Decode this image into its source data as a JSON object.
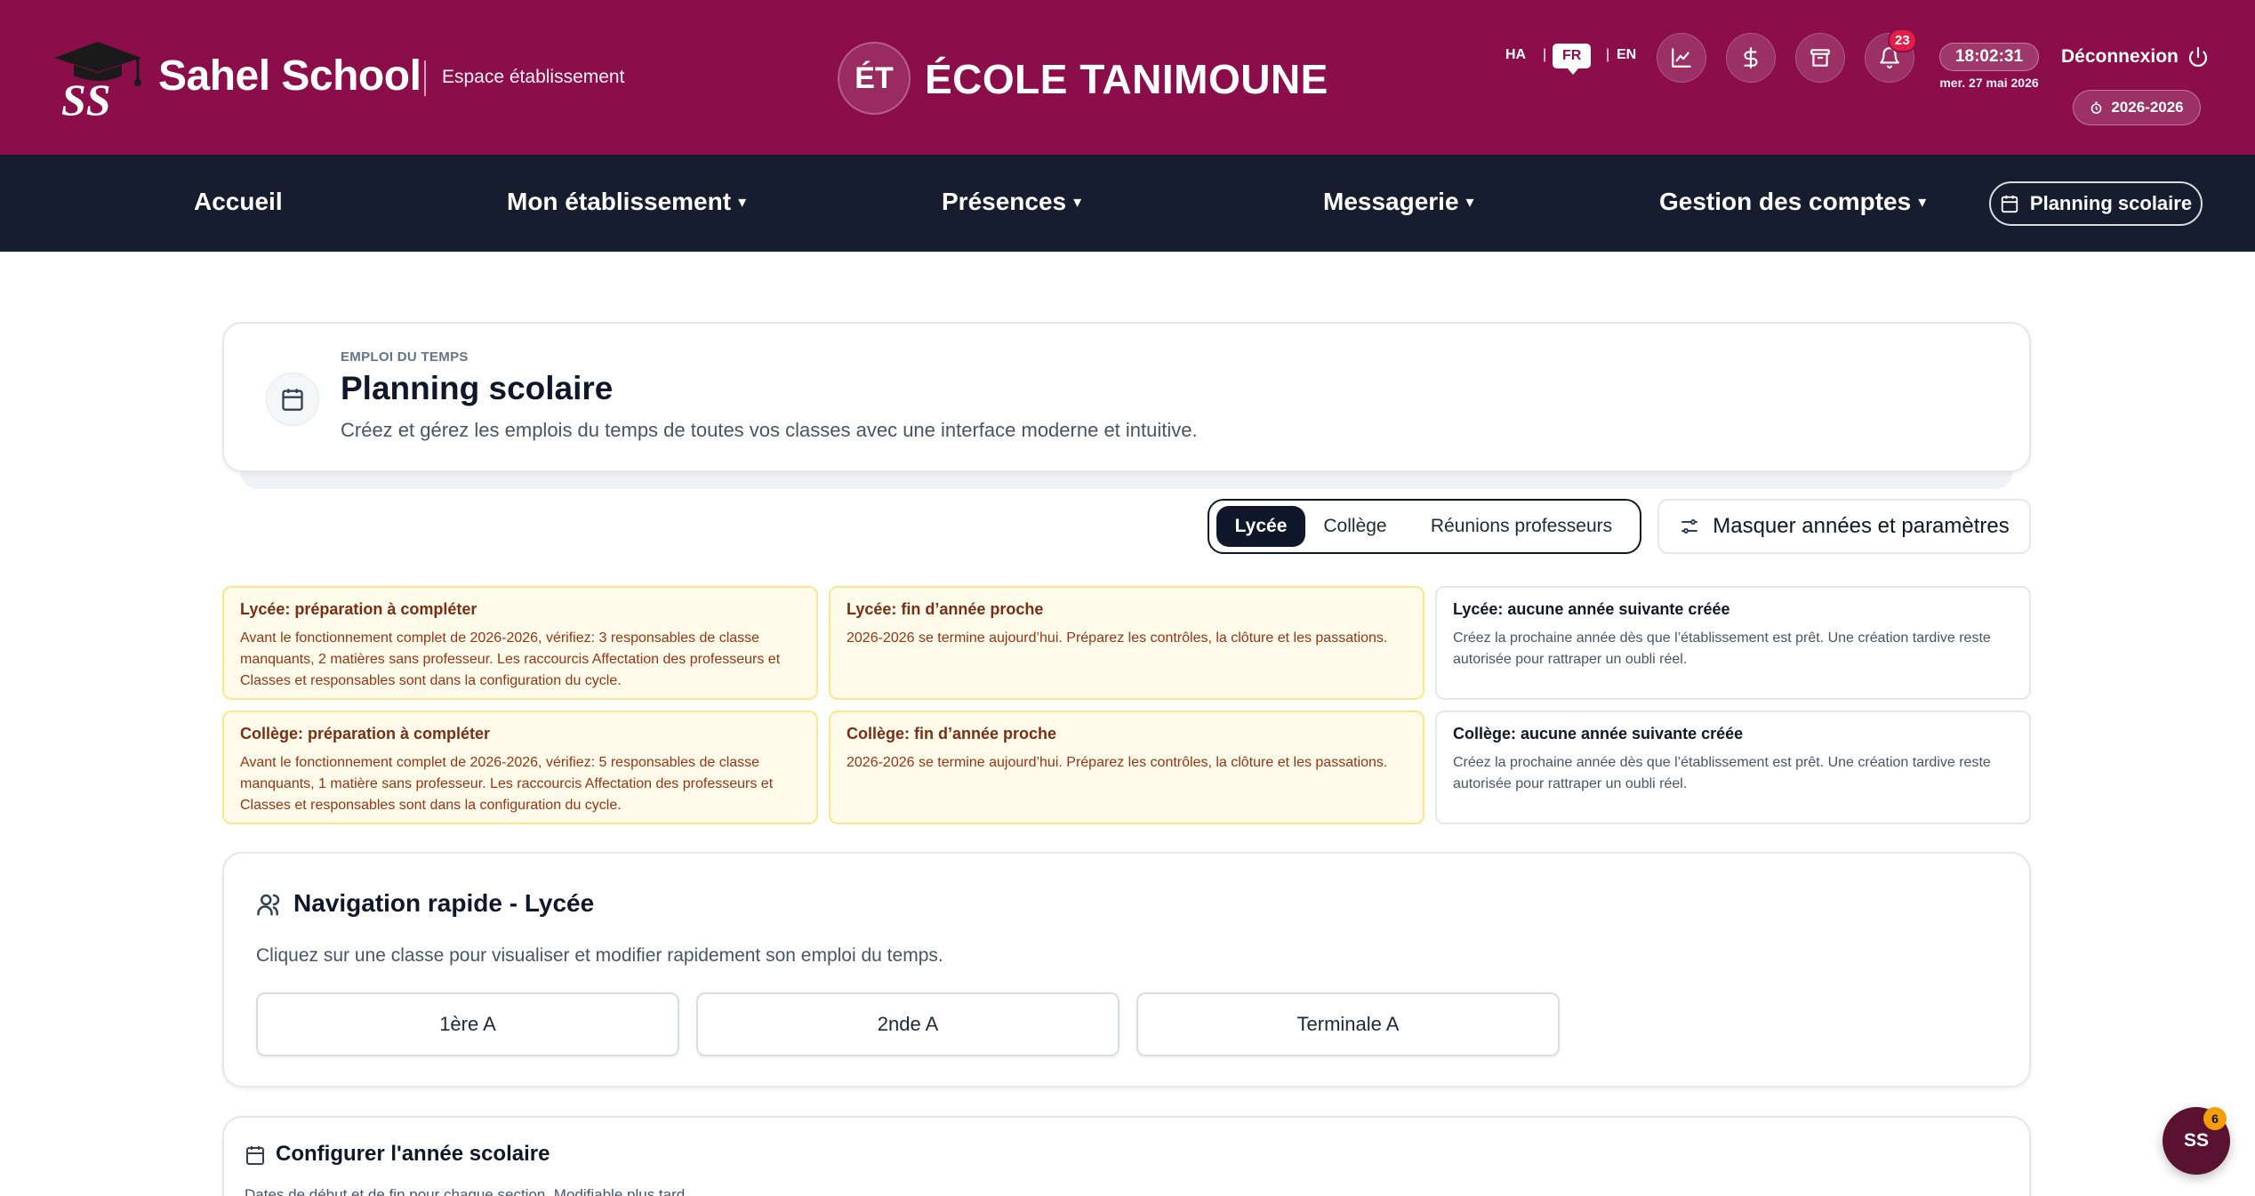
{
  "header": {
    "brand": "Sahel School",
    "brand_sub": "Espace établissement",
    "school_initials": "ÉT",
    "school_name": "ÉCOLE TANIMOUNE",
    "languages": {
      "ha": "HA",
      "fr": "FR",
      "en": "EN",
      "separator": "|"
    },
    "notifications_count": "23",
    "time": "18:02:31",
    "date": "mer. 27 mai 2026",
    "logout_label": "Déconnexion",
    "school_year": "2026-2026",
    "icons": [
      "chart-icon",
      "dollar-icon",
      "archive-icon",
      "bell-icon"
    ],
    "colors": {
      "primary": "#8b0e4b",
      "nav": "#151d2f"
    }
  },
  "nav": {
    "items": [
      {
        "label": "Accueil",
        "dropdown": ""
      },
      {
        "label": "Mon établissement",
        "dropdown": "▾"
      },
      {
        "label": "Présences",
        "dropdown": "▾"
      },
      {
        "label": "Messagerie",
        "dropdown": "▾"
      },
      {
        "label": "Gestion des comptes",
        "dropdown": "▾"
      }
    ],
    "planning_label": "Planning scolaire"
  },
  "hero": {
    "eyebrow": "EMPLOI DU TEMPS",
    "title": "Planning scolaire",
    "description": "Créez et gérez les emplois du temps de toutes vos classes avec une interface moderne et intuitive."
  },
  "tabs": {
    "options": [
      "Lycée",
      "Collège",
      "Réunions professeurs"
    ],
    "active": "Lycée",
    "toggle_label": "Masquer années et paramètres"
  },
  "alerts": [
    {
      "type": "warning",
      "title": "Lycée: préparation à compléter",
      "body": "Avant le fonctionnement complet de 2026-2026, vérifiez: 3 responsables de classe manquants, 2 matières sans professeur. Les raccourcis Affectation des professeurs et Classes et responsables sont dans la configuration du cycle."
    },
    {
      "type": "warning",
      "title": "Lycée: fin d’année proche",
      "body": "2026-2026 se termine aujourd’hui. Préparez les contrôles, la clôture et les passations."
    },
    {
      "type": "info",
      "title": "Lycée: aucune année suivante créée",
      "body": "Créez la prochaine année dès que l’établissement est prêt. Une création tardive reste autorisée pour rattraper un oubli réel."
    },
    {
      "type": "warning",
      "title": "Collège: préparation à compléter",
      "body": "Avant le fonctionnement complet de 2026-2026, vérifiez: 5 responsables de classe manquants, 1 matière sans professeur. Les raccourcis Affectation des professeurs et Classes et responsables sont dans la configuration du cycle."
    },
    {
      "type": "warning",
      "title": "Collège: fin d’année proche",
      "body": "2026-2026 se termine aujourd’hui. Préparez les contrôles, la clôture et les passations."
    },
    {
      "type": "info",
      "title": "Collège: aucune année suivante créée",
      "body": "Créez la prochaine année dès que l’établissement est prêt. Une création tardive reste autorisée pour rattraper un oubli réel."
    }
  ],
  "quick_nav": {
    "title": "Navigation rapide - Lycée",
    "description": "Cliquez sur une classe pour visualiser et modifier rapidement son emploi du temps.",
    "classes": [
      "1ère A",
      "2nde A",
      "Terminale A"
    ]
  },
  "config": {
    "title": "Configurer l'année scolaire",
    "description": "Dates de début et de fin pour chaque section. Modifiable plus tard."
  },
  "fab": {
    "initials": "SS",
    "badge": "6"
  }
}
